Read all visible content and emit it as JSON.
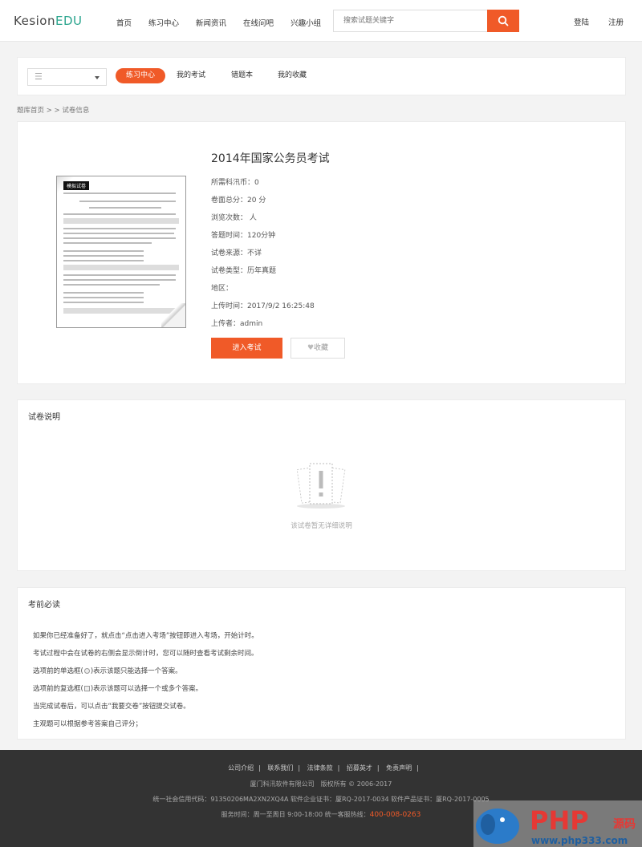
{
  "header": {
    "logo_main": "Kesion",
    "logo_accent": "EDU",
    "nav": [
      "首页",
      "练习中心",
      "新闻资讯",
      "在线问吧",
      "兴趣小组"
    ],
    "search_placeholder": "搜索试题关键字",
    "login": "登陆",
    "register": "注册"
  },
  "tabbar": {
    "tabs": [
      "练习中心",
      "我的考试",
      "错题本",
      "我的收藏"
    ],
    "active": 0
  },
  "breadcrumb": "题库首页 >   > 试卷信息",
  "exam": {
    "title": "2014年国家公务员考试",
    "meta": [
      "所需科汛币：0",
      "卷面总分：20 分",
      "浏览次数： 人",
      "答题时间：120分钟",
      "试卷来源：不详",
      "试卷类型：历年真题",
      "地区：",
      "上传时间：2017/9/2 16:25:48",
      "上传者：admin"
    ],
    "enter_button": "进入考试",
    "fav_button": "收藏",
    "thumb_flag": "模拟试卷"
  },
  "description": {
    "title": "试卷说明",
    "empty_text": "该试卷暂无详细说明"
  },
  "notes": {
    "title": "考前必读",
    "items": [
      "如果你已经准备好了，就点击“点击进入考场”按钮即进入考场，开始计时。",
      "考试过程中会在试卷的右侧会显示倒计时，您可以随时查看考试剩余时间。",
      "选项前的单选框(",
      ")表示该题只能选择一个答案。",
      "选项前的复选框(",
      ")表示该题可以选择一个或多个答案。",
      "当完成试卷后，可以点击“我要交卷”按钮提交试卷。",
      "主观题可以根据参考答案自己评分；"
    ]
  },
  "footer": {
    "links": [
      "公司介绍",
      "联系我们",
      "法律条款",
      "招募英才",
      "免责声明"
    ],
    "company": "厦门科汛软件有限公司　版权所有 © 2006-2017",
    "license": "统一社会信用代码：91350206MA2XN2XQ4A 软件企业证书：厦RQ-2017-0034 软件产品证书：厦RQ-2017-0005",
    "service": "服务时间：周一至周日 9:00-18:00 统一客服热线：",
    "hotline": "400-008-0263"
  },
  "watermark": {
    "brand": "PHP",
    "tag": "源码",
    "url": "www.php333.com"
  },
  "colors": {
    "accent": "#f05a28",
    "logo_accent": "#2ba58e",
    "footer_bg": "#333333"
  }
}
